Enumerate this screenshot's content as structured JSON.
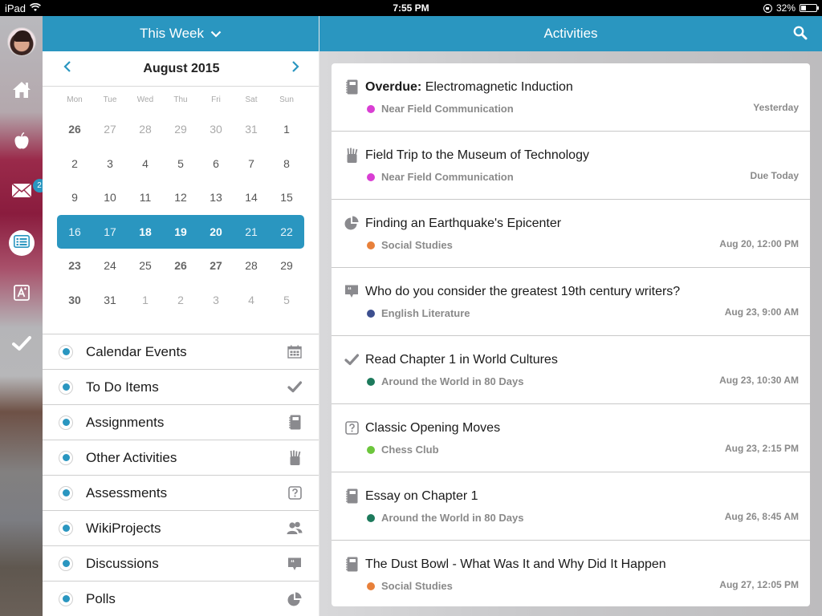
{
  "status_bar": {
    "device": "iPad",
    "time": "7:55 PM",
    "battery_percent_label": "32%",
    "battery_level": 0.32
  },
  "nav_rail": {
    "items": [
      {
        "name": "home",
        "icon": "home-icon"
      },
      {
        "name": "courses",
        "icon": "apple-icon"
      },
      {
        "name": "messages",
        "icon": "envelope-icon",
        "badge": "2"
      },
      {
        "name": "activities",
        "icon": "list-icon",
        "active": true
      },
      {
        "name": "grades",
        "icon": "grade-a-icon"
      },
      {
        "name": "todo",
        "icon": "checkmark-icon"
      }
    ]
  },
  "left_panel": {
    "header_title": "This Week",
    "month_title": "August 2015",
    "weekdays": [
      "Mon",
      "Tue",
      "Wed",
      "Thu",
      "Fri",
      "Sat",
      "Sun"
    ],
    "weeks": [
      [
        {
          "d": "26",
          "s": "bold"
        },
        {
          "d": "27",
          "s": "dim"
        },
        {
          "d": "28",
          "s": "dim"
        },
        {
          "d": "29",
          "s": "dim"
        },
        {
          "d": "30",
          "s": "dim"
        },
        {
          "d": "31",
          "s": "dim"
        },
        {
          "d": "1",
          "s": ""
        }
      ],
      [
        {
          "d": "2",
          "s": ""
        },
        {
          "d": "3",
          "s": ""
        },
        {
          "d": "4",
          "s": ""
        },
        {
          "d": "5",
          "s": ""
        },
        {
          "d": "6",
          "s": ""
        },
        {
          "d": "7",
          "s": ""
        },
        {
          "d": "8",
          "s": ""
        }
      ],
      [
        {
          "d": "9",
          "s": ""
        },
        {
          "d": "10",
          "s": ""
        },
        {
          "d": "11",
          "s": ""
        },
        {
          "d": "12",
          "s": ""
        },
        {
          "d": "13",
          "s": ""
        },
        {
          "d": "14",
          "s": ""
        },
        {
          "d": "15",
          "s": ""
        }
      ],
      [
        {
          "d": "16",
          "s": ""
        },
        {
          "d": "17",
          "s": ""
        },
        {
          "d": "18",
          "s": "bold"
        },
        {
          "d": "19",
          "s": "bold"
        },
        {
          "d": "20",
          "s": "bold"
        },
        {
          "d": "21",
          "s": ""
        },
        {
          "d": "22",
          "s": ""
        }
      ],
      [
        {
          "d": "23",
          "s": "bold"
        },
        {
          "d": "24",
          "s": ""
        },
        {
          "d": "25",
          "s": ""
        },
        {
          "d": "26",
          "s": "bold"
        },
        {
          "d": "27",
          "s": "bold"
        },
        {
          "d": "28",
          "s": ""
        },
        {
          "d": "29",
          "s": ""
        }
      ],
      [
        {
          "d": "30",
          "s": "bold"
        },
        {
          "d": "31",
          "s": ""
        },
        {
          "d": "1",
          "s": "dim"
        },
        {
          "d": "2",
          "s": "dim"
        },
        {
          "d": "3",
          "s": "dim"
        },
        {
          "d": "4",
          "s": "dim"
        },
        {
          "d": "5",
          "s": "dim"
        }
      ]
    ],
    "selected_week_index": 3,
    "filters": [
      {
        "label": "Calendar Events",
        "icon": "calendar-icon",
        "selected": true
      },
      {
        "label": "To Do Items",
        "icon": "checkmark-icon",
        "selected": true
      },
      {
        "label": "Assignments",
        "icon": "notebook-icon",
        "selected": true
      },
      {
        "label": "Other Activities",
        "icon": "pencil-cup-icon",
        "selected": true
      },
      {
        "label": "Assessments",
        "icon": "question-box-icon",
        "selected": true
      },
      {
        "label": "WikiProjects",
        "icon": "people-icon",
        "selected": true
      },
      {
        "label": "Discussions",
        "icon": "quote-bubble-icon",
        "selected": true
      },
      {
        "label": "Polls",
        "icon": "pie-chart-icon",
        "selected": true
      }
    ]
  },
  "right_panel": {
    "header_title": "Activities",
    "activities": [
      {
        "prefix": "Overdue:",
        "title": "Electromagnetic Induction",
        "icon": "notebook-icon",
        "course": "Near Field Communication",
        "course_color": "#d93ed3",
        "date": "Yesterday"
      },
      {
        "prefix": "",
        "title": "Field Trip to the Museum of Technology",
        "icon": "pencil-cup-icon",
        "course": "Near Field Communication",
        "course_color": "#d93ed3",
        "date": "Due Today"
      },
      {
        "prefix": "",
        "title": "Finding an Earthquake's Epicenter",
        "icon": "pie-chart-icon",
        "course": "Social Studies",
        "course_color": "#e8803a",
        "date": "Aug 20, 12:00 PM"
      },
      {
        "prefix": "",
        "title": "Who do you consider the greatest 19th century writers?",
        "icon": "quote-bubble-icon",
        "course": "English Literature",
        "course_color": "#3d4f8f",
        "date": "Aug 23, 9:00 AM"
      },
      {
        "prefix": "",
        "title": "Read Chapter 1 in World Cultures",
        "icon": "checkmark-icon",
        "course": "Around the World in 80 Days",
        "course_color": "#1d7a5c",
        "date": "Aug 23, 10:30 AM"
      },
      {
        "prefix": "",
        "title": "Classic Opening Moves",
        "icon": "question-box-icon",
        "course": "Chess Club",
        "course_color": "#6cc63c",
        "date": "Aug 23, 2:15 PM"
      },
      {
        "prefix": "",
        "title": "Essay on Chapter 1",
        "icon": "notebook-icon",
        "course": "Around the World in 80 Days",
        "course_color": "#1d7a5c",
        "date": "Aug 26, 8:45 AM"
      },
      {
        "prefix": "",
        "title": "The Dust Bowl - What Was It and Why Did It Happen",
        "icon": "notebook-icon",
        "course": "Social Studies",
        "course_color": "#e8803a",
        "date": "Aug 27, 12:05 PM"
      }
    ]
  },
  "colors": {
    "accent": "#2a96c0",
    "icon_gray": "#8a8a8e"
  }
}
